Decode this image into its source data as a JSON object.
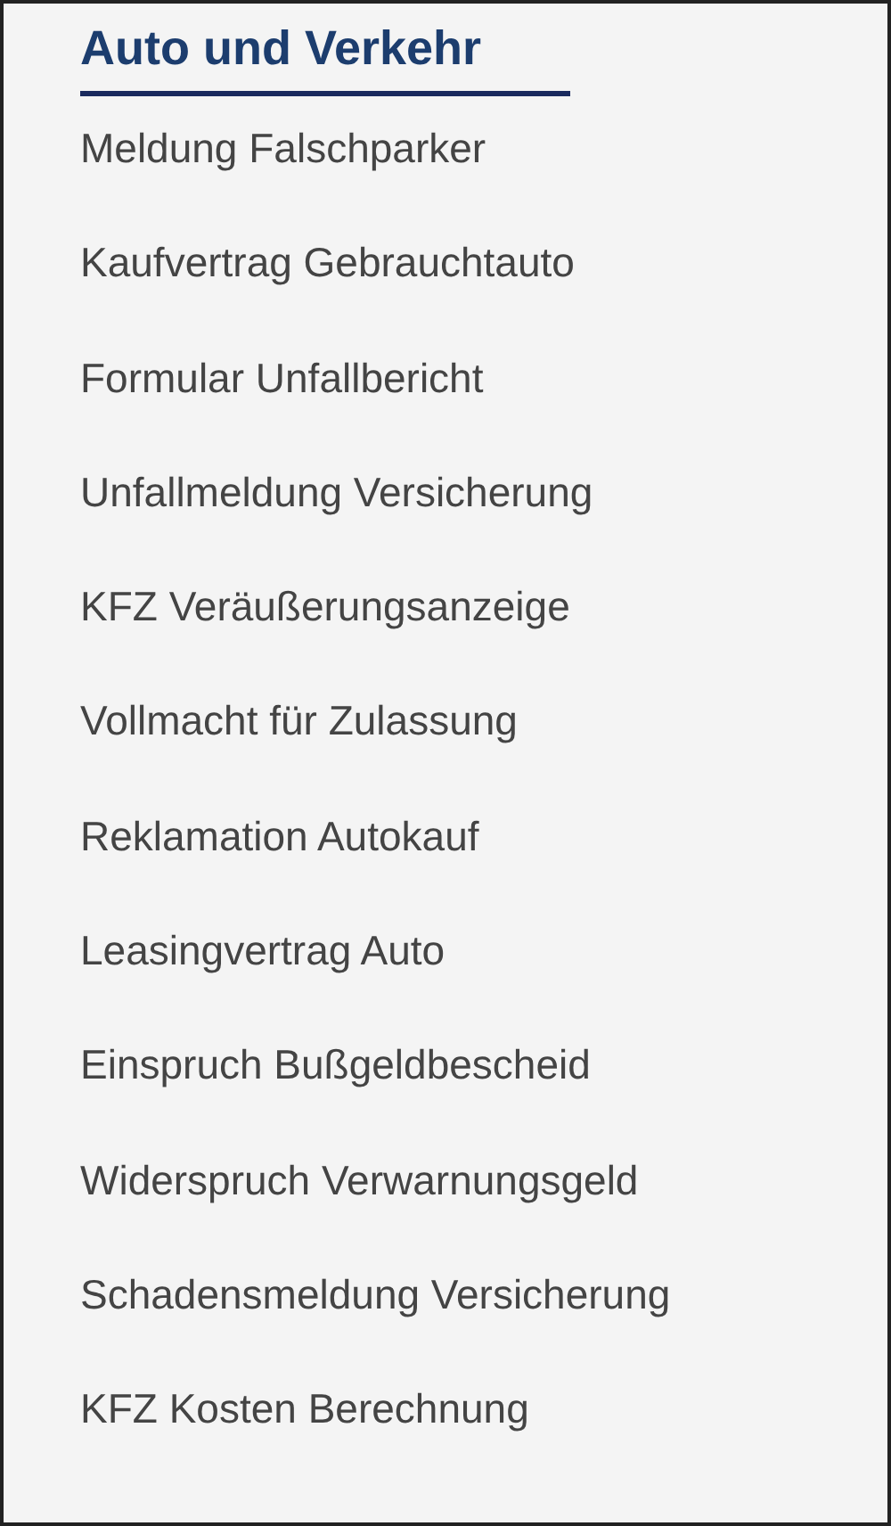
{
  "heading": "Auto und Verkehr",
  "links": [
    "Meldung Falschparker",
    "Kaufvertrag Gebrauchtauto",
    "Formular Unfallbericht",
    "Unfallmeldung Versicherung",
    "KFZ Veräußerungsanzeige",
    "Vollmacht für Zulassung",
    "Reklamation Autokauf",
    "Leasingvertrag Auto",
    "Einspruch Bußgeldbescheid",
    "Widerspruch Verwarnungsgeld",
    "Schadensmeldung Versicherung",
    "KFZ Kosten Berechnung"
  ]
}
